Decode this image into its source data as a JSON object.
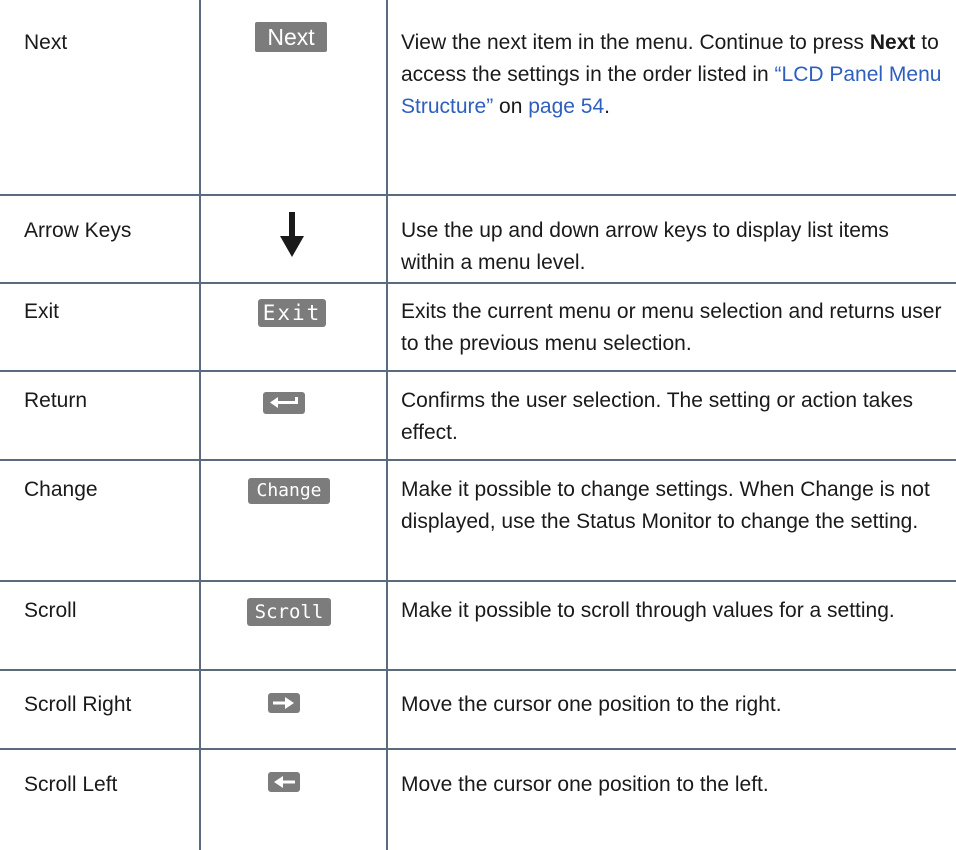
{
  "rows": [
    {
      "name": "Next",
      "key_label": "Next",
      "key_icon": "next-key",
      "desc_pre": "View the next item in the menu. Continue to press ",
      "desc_bold": "Next",
      "desc_mid": " to access the settings in the order listed in ",
      "desc_link": "“LCD Panel Menu Structure”",
      "desc_mid2": " on ",
      "desc_link2": "page 54",
      "desc_post": "."
    },
    {
      "name": "Arrow Keys",
      "key_icon": "down-arrow-icon",
      "desc": "Use the up and down arrow keys to display list items within a menu level."
    },
    {
      "name": "Exit",
      "key_label": "Exit",
      "key_icon": "exit-key",
      "desc": "Exits the current menu or menu selection and returns user to the previous menu selection."
    },
    {
      "name": "Return",
      "key_icon": "return-key-icon",
      "desc": "Confirms the user selection. The setting or action takes effect."
    },
    {
      "name": "Change",
      "key_label": "Change",
      "key_icon": "change-key",
      "desc": "Make it possible to change settings. When Change is not displayed, use the Status Monitor to change the setting."
    },
    {
      "name": "Scroll",
      "key_label": "Scroll",
      "key_icon": "scroll-key",
      "desc": "Make it possible to scroll through values for a setting."
    },
    {
      "name": "Scroll Right",
      "key_icon": "scroll-right-key-icon",
      "desc": "Move the cursor one position to the right."
    },
    {
      "name": "Scroll Left",
      "key_icon": "scroll-left-key-icon",
      "desc": "Move the cursor one position to the left."
    }
  ],
  "colors": {
    "rule": "#5b6a7c",
    "link": "#2e5fbf",
    "keycap": "#7c7c7c"
  }
}
